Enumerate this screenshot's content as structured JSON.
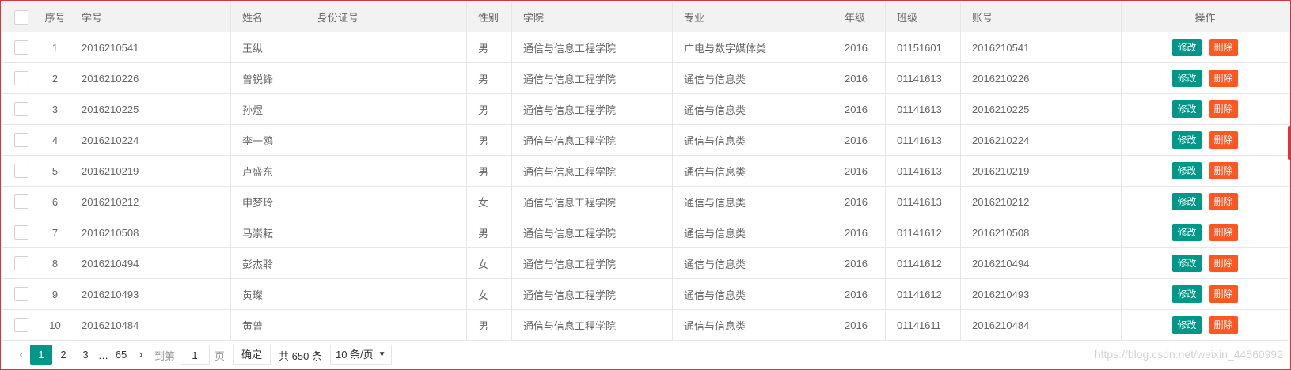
{
  "table": {
    "headers": {
      "index": "序号",
      "student_id": "学号",
      "name": "姓名",
      "id_card": "身份证号",
      "gender": "性别",
      "college": "学院",
      "major": "专业",
      "grade": "年级",
      "class": "班级",
      "account": "账号",
      "ops": "操作"
    },
    "edit_label": "修改",
    "delete_label": "删除",
    "rows": [
      {
        "index": "1",
        "student_id": "2016210541",
        "name": "王纵",
        "id_card": "",
        "gender": "男",
        "college": "通信与信息工程学院",
        "major": "广电与数字媒体类",
        "grade": "2016",
        "class": "01151601",
        "account": "2016210541"
      },
      {
        "index": "2",
        "student_id": "2016210226",
        "name": "曾锐锋",
        "id_card": "",
        "gender": "男",
        "college": "通信与信息工程学院",
        "major": "通信与信息类",
        "grade": "2016",
        "class": "01141613",
        "account": "2016210226"
      },
      {
        "index": "3",
        "student_id": "2016210225",
        "name": "孙煜",
        "id_card": "",
        "gender": "男",
        "college": "通信与信息工程学院",
        "major": "通信与信息类",
        "grade": "2016",
        "class": "01141613",
        "account": "2016210225"
      },
      {
        "index": "4",
        "student_id": "2016210224",
        "name": "李一鸥",
        "id_card": "",
        "gender": "男",
        "college": "通信与信息工程学院",
        "major": "通信与信息类",
        "grade": "2016",
        "class": "01141613",
        "account": "2016210224"
      },
      {
        "index": "5",
        "student_id": "2016210219",
        "name": "卢盛东",
        "id_card": "",
        "gender": "男",
        "college": "通信与信息工程学院",
        "major": "通信与信息类",
        "grade": "2016",
        "class": "01141613",
        "account": "2016210219"
      },
      {
        "index": "6",
        "student_id": "2016210212",
        "name": "申梦玲",
        "id_card": "",
        "gender": "女",
        "college": "通信与信息工程学院",
        "major": "通信与信息类",
        "grade": "2016",
        "class": "01141613",
        "account": "2016210212"
      },
      {
        "index": "7",
        "student_id": "2016210508",
        "name": "马崇耘",
        "id_card": "",
        "gender": "男",
        "college": "通信与信息工程学院",
        "major": "通信与信息类",
        "grade": "2016",
        "class": "01141612",
        "account": "2016210508"
      },
      {
        "index": "8",
        "student_id": "2016210494",
        "name": "彭杰聆",
        "id_card": "",
        "gender": "女",
        "college": "通信与信息工程学院",
        "major": "通信与信息类",
        "grade": "2016",
        "class": "01141612",
        "account": "2016210494"
      },
      {
        "index": "9",
        "student_id": "2016210493",
        "name": "黄璨",
        "id_card": "",
        "gender": "女",
        "college": "通信与信息工程学院",
        "major": "通信与信息类",
        "grade": "2016",
        "class": "01141612",
        "account": "2016210493"
      },
      {
        "index": "10",
        "student_id": "2016210484",
        "name": "黄曾",
        "id_card": "",
        "gender": "男",
        "college": "通信与信息工程学院",
        "major": "通信与信息类",
        "grade": "2016",
        "class": "01141611",
        "account": "2016210484"
      }
    ]
  },
  "pagination": {
    "prev_icon": "chevron-left-icon",
    "next_icon": "chevron-right-icon",
    "pages": [
      "1",
      "2",
      "3"
    ],
    "ellipsis": "…",
    "last_page": "65",
    "current_page": "1",
    "goto_label": "到第",
    "goto_value": "1",
    "page_unit": "页",
    "confirm_label": "确定",
    "total_label": "共 650 条",
    "page_size_label": "10 条/页",
    "page_size_caret": "▼"
  },
  "watermark": "https://blog.csdn.net/weixin_44560992",
  "colors": {
    "edit": "#009688",
    "delete": "#ff5722",
    "active_page": "#009688",
    "border_accent": "#d8343a"
  }
}
